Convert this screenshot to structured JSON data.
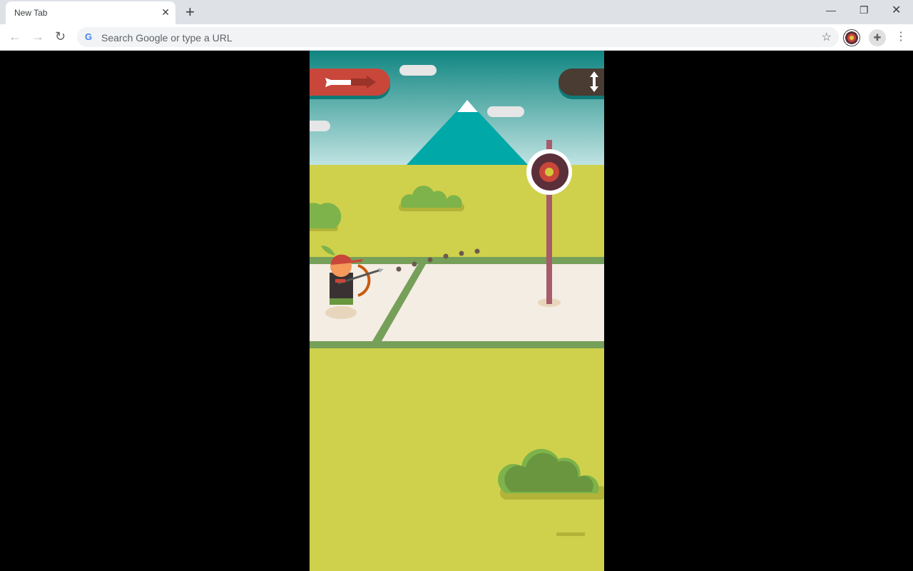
{
  "browser": {
    "tab_title": "New Tab",
    "omnibox_placeholder": "Search Google or type a URL"
  },
  "icons": [
    "close-icon",
    "plus-icon",
    "minimize-icon",
    "restore-icon",
    "back-icon",
    "forward-icon",
    "reload-icon",
    "google-icon",
    "star-icon",
    "archery-extension-icon",
    "puzzle-icon",
    "menu-icon"
  ],
  "game": {
    "colors": {
      "sky_top": "#0f8580",
      "sky_bottom": "#bfe3e2",
      "grass": "#cfd14c",
      "track": "#f4ede4",
      "lines": "#76a05a",
      "mountain": "#00a8a8",
      "left_button": "#c9463a",
      "right_button": "#4a3b33"
    },
    "left_button_icon": "arrow-right-icon",
    "right_button_icon": "vertical-arrows-icon"
  }
}
